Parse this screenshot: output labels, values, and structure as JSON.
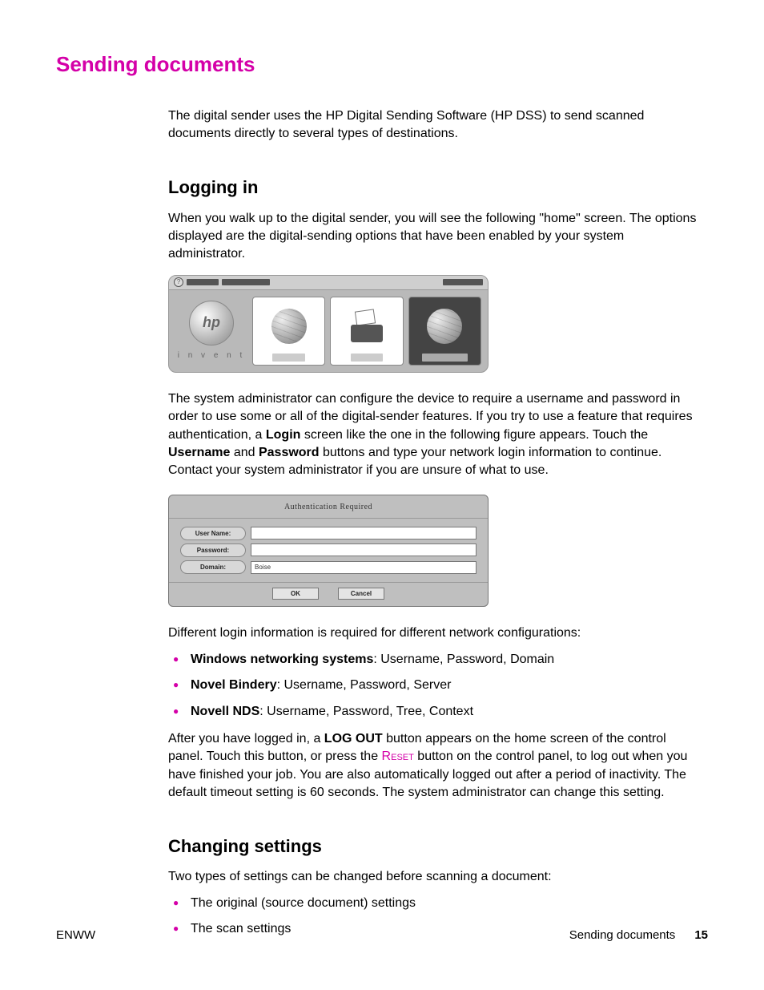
{
  "page_title": "Sending documents",
  "intro": "The digital sender uses the HP Digital Sending Software (HP DSS) to send scanned documents directly to several types of destinations.",
  "section_login": {
    "heading": "Logging in",
    "p1": "When you walk up to the digital sender, you will see the following \"home\" screen. The options displayed are the digital-sending options that have been enabled by your system administrator.",
    "p2a": "The system administrator can configure the device to require a username and password in order to use some or all of the digital-sender features. If you try to use a feature that requires authentication, a ",
    "p2_login": "Login",
    "p2b": " screen like the one in the following figure appears. Touch the ",
    "p2_user": "Username",
    "p2c": " and ",
    "p2_pass": "Password",
    "p2d": " buttons and type your network login information to continue. Contact your system administrator if you are unsure of what to use.",
    "p3": "Different login information is required for different network configurations:",
    "bullets": [
      {
        "b": "Windows networking systems",
        "rest": ": Username, Password, Domain"
      },
      {
        "b": "Novel Bindery",
        "rest": ": Username, Password, Server"
      },
      {
        "b": "Novell NDS",
        "rest": ": Username, Password, Tree, Context"
      }
    ],
    "p4a": "After you have logged in, a ",
    "p4_logout": "LOG OUT",
    "p4b": " button appears on the home screen of the control panel. Touch this button, or press the ",
    "p4_reset": "Reset",
    "p4c": " button on the control panel, to log out when you have finished your job. You are also automatically logged out after a period of inactivity. The default timeout setting is 60 seconds. The system administrator can change this setting."
  },
  "section_settings": {
    "heading": "Changing settings",
    "p1": "Two types of settings can be changed before scanning a document:",
    "bullets": [
      "The original (source document) settings",
      "The scan settings"
    ]
  },
  "home_fig": {
    "logo_text": "i n v e n t",
    "hp": "hp"
  },
  "login_fig": {
    "title": "Authentication Required",
    "labels": {
      "user": "User Name:",
      "pass": "Password:",
      "domain": "Domain:"
    },
    "domain_value": "Boise",
    "ok": "OK",
    "cancel": "Cancel"
  },
  "footer": {
    "left": "ENWW",
    "section": "Sending documents",
    "page": "15"
  }
}
